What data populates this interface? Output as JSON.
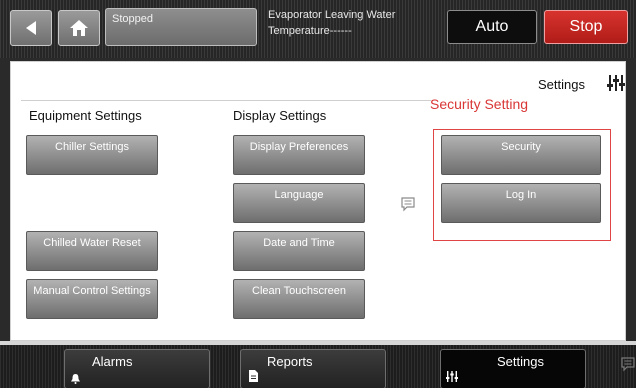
{
  "topbar": {
    "status_text": "Stopped",
    "evap_line1": "Evaporator Leaving Water",
    "evap_line2": "Temperature------",
    "auto_label": "Auto",
    "stop_label": "Stop"
  },
  "page": {
    "title": "Settings"
  },
  "columns": {
    "equipment_heading": "Equipment Settings",
    "display_heading": "Display Settings",
    "security_heading": "Security Setting"
  },
  "buttons": {
    "chiller_settings": "Chiller Settings",
    "chilled_water_reset": "Chilled Water Reset",
    "manual_control_settings": "Manual Control Settings",
    "display_preferences": "Display Preferences",
    "language": "Language",
    "date_and_time": "Date and Time",
    "clean_touchscreen": "Clean Touchscreen",
    "security": "Security",
    "log_in": "Log In"
  },
  "nav": {
    "alarms": "Alarms",
    "reports": "Reports",
    "settings": "Settings"
  },
  "colors": {
    "accent_red": "#d93636",
    "stop_red": "#c42520"
  }
}
